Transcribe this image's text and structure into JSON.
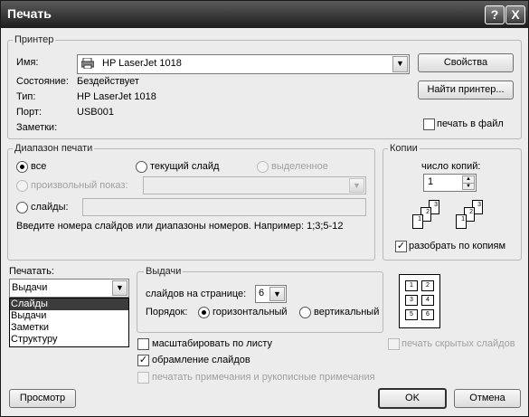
{
  "window": {
    "title": "Печать",
    "help_btn": "?",
    "close_btn": "X"
  },
  "printer": {
    "group_label": "Принтер",
    "name_label": "Имя:",
    "name_value": "HP LaserJet 1018",
    "status_label": "Состояние:",
    "status_value": "Бездействует",
    "type_label": "Тип:",
    "type_value": "HP LaserJet 1018",
    "port_label": "Порт:",
    "port_value": "USB001",
    "notes_label": "Заметки:",
    "properties_btn": "Свойства",
    "find_btn": "Найти принтер...",
    "print_to_file": "печать в файл"
  },
  "range": {
    "group_label": "Диапазон печати",
    "all": "все",
    "current": "текущий слайд",
    "selection": "выделенное",
    "custom_show": "произвольный показ:",
    "slides": "слайды:",
    "hint": "Введите номера слайдов или диапазоны номеров. Например: 1;3;5-12"
  },
  "copies": {
    "group_label": "Копии",
    "count_label": "число копий:",
    "count_value": "1",
    "collate": "разобрать по копиям",
    "page_numbers": [
      "1",
      "2",
      "3"
    ]
  },
  "print_what": {
    "label": "Печатать:",
    "value": "Выдачи",
    "options": [
      "Слайды",
      "Выдачи",
      "Заметки",
      "Структуру"
    ]
  },
  "handouts": {
    "group_label": "Выдачи",
    "per_page_label": "слайдов на странице:",
    "per_page_value": "6",
    "order_label": "Порядок:",
    "horizontal": "горизонтальный",
    "vertical": "вертикальный",
    "preview_cells": [
      "1",
      "2",
      "3",
      "4",
      "5",
      "6"
    ]
  },
  "options": {
    "scale_to_fit": "масштабировать по листу",
    "frame_slides": "обрамление слайдов",
    "print_comments": "печатать примечания и рукописные примечания",
    "print_hidden": "печать скрытых слайдов"
  },
  "buttons": {
    "preview": "Просмотр",
    "ok": "OK",
    "cancel": "Отмена"
  },
  "icons": {
    "printer": "printer-icon",
    "dropdown": "chevron-down-icon"
  }
}
